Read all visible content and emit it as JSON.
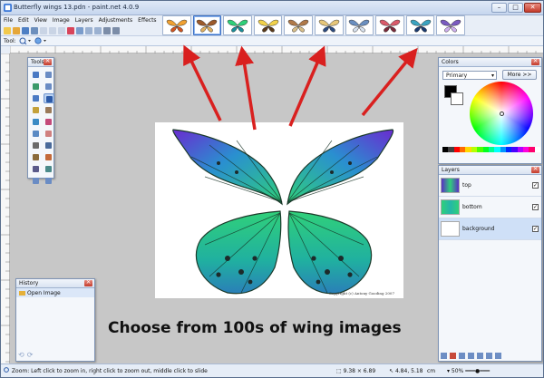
{
  "window": {
    "title": "Butterfly wings 13.pdn - paint.net 4.0.9",
    "minimize_glyph": "–",
    "maximize_glyph": "□",
    "close_glyph": "✕"
  },
  "menu": [
    "File",
    "Edit",
    "View",
    "Image",
    "Layers",
    "Adjustments",
    "Effects"
  ],
  "toolbar": {
    "tool_label": "Tool:"
  },
  "thumbnails": {
    "count": 10,
    "selected_index": 1
  },
  "panels": {
    "tools": {
      "title": "Tools"
    },
    "history": {
      "title": "History",
      "items": [
        "Open Image"
      ]
    },
    "colors": {
      "title": "Colors",
      "mode": "Primary",
      "more_button": "More >>"
    },
    "layers": {
      "title": "Layers",
      "items": [
        {
          "name": "top",
          "checked": true
        },
        {
          "name": "bottom",
          "checked": true
        },
        {
          "name": "background",
          "checked": true
        }
      ]
    }
  },
  "canvas": {
    "copyright": "Copyright (c) Antony Gooding 2007"
  },
  "caption": "Choose from 100s of wing images",
  "status": {
    "hint": "Zoom: Left click to zoom in, right click to zoom out, middle click to slide",
    "image_size": "9.38 × 6.89",
    "cursor": "4.84, 5.18",
    "units": "cm",
    "zoom": "50%"
  },
  "colors": {
    "arrow": "#d9201f",
    "wing_green": "#2fd07a",
    "wing_purple": "#5b2fc4",
    "wing_teal": "#24b6a8"
  }
}
